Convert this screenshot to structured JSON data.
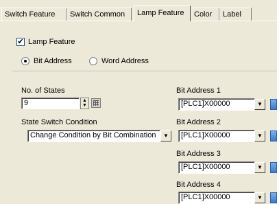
{
  "tabs": [
    {
      "label": "Switch Feature"
    },
    {
      "label": "Switch Common"
    },
    {
      "label": "Lamp Feature"
    },
    {
      "label": "Color"
    },
    {
      "label": "Label"
    }
  ],
  "lamp_feature": {
    "label": "Lamp Feature",
    "checked": true
  },
  "address_type": {
    "bit_label": "Bit Address",
    "word_label": "Word Address",
    "selected": "Bit Address"
  },
  "states": {
    "label": "No. of States",
    "value": "9"
  },
  "condition": {
    "label": "State Switch Condition",
    "value": "Change Condition by Bit Combination"
  },
  "bit_addresses": [
    {
      "label": "Bit Address 1",
      "value": "[PLC1]X00000"
    },
    {
      "label": "Bit Address 2",
      "value": "[PLC1]X00000"
    },
    {
      "label": "Bit Address 3",
      "value": "[PLC1]X00000"
    },
    {
      "label": "Bit Address 4",
      "value": "[PLC1]X00000"
    }
  ],
  "icons": {
    "checkbox_mark": "✔",
    "dropdown": "▼",
    "spin_up": "▲",
    "spin_down": "▼"
  }
}
